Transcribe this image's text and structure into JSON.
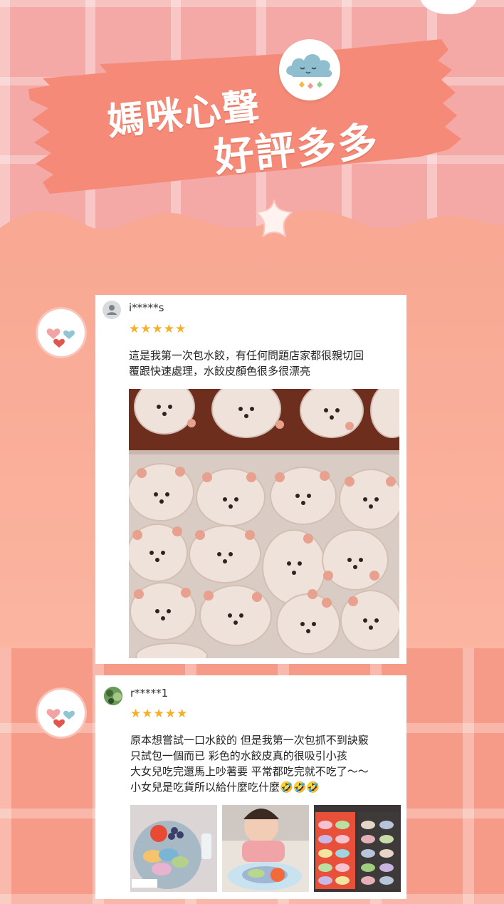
{
  "header": {
    "title_line1": "媽咪心聲",
    "title_line2": "好評多多"
  },
  "icons": {
    "cloud": "smiling-cloud-icon",
    "star": "star-icon",
    "hearts": "hearts-icon",
    "user": "user-placeholder-icon"
  },
  "colors": {
    "banner": "#f58a78",
    "star_rating": "#f6b028",
    "background_top": "#f4a9a6",
    "background_bottom": "#f69b88"
  },
  "reviews": [
    {
      "username": "i*****s",
      "rating": 5,
      "stars": "★★★★★",
      "text_lines": [
        "這是我第一次包水餃，有任何問題店家都很親切回",
        "覆跟快速處理，水餃皮顏色很多很漂亮"
      ]
    },
    {
      "username": "r*****1",
      "rating": 5,
      "stars": "★★★★★",
      "text_lines": [
        "原本想嘗試一口水餃的 但是我第一次包抓不到訣竅",
        "只試包一個而已 彩色的水餃皮真的很吸引小孩",
        "大女兒吃完還馬上吵著要 平常都吃完就不吃了～～",
        "小女兒是吃貨所以給什麼吃什麼🤣🤣🤣"
      ]
    }
  ]
}
